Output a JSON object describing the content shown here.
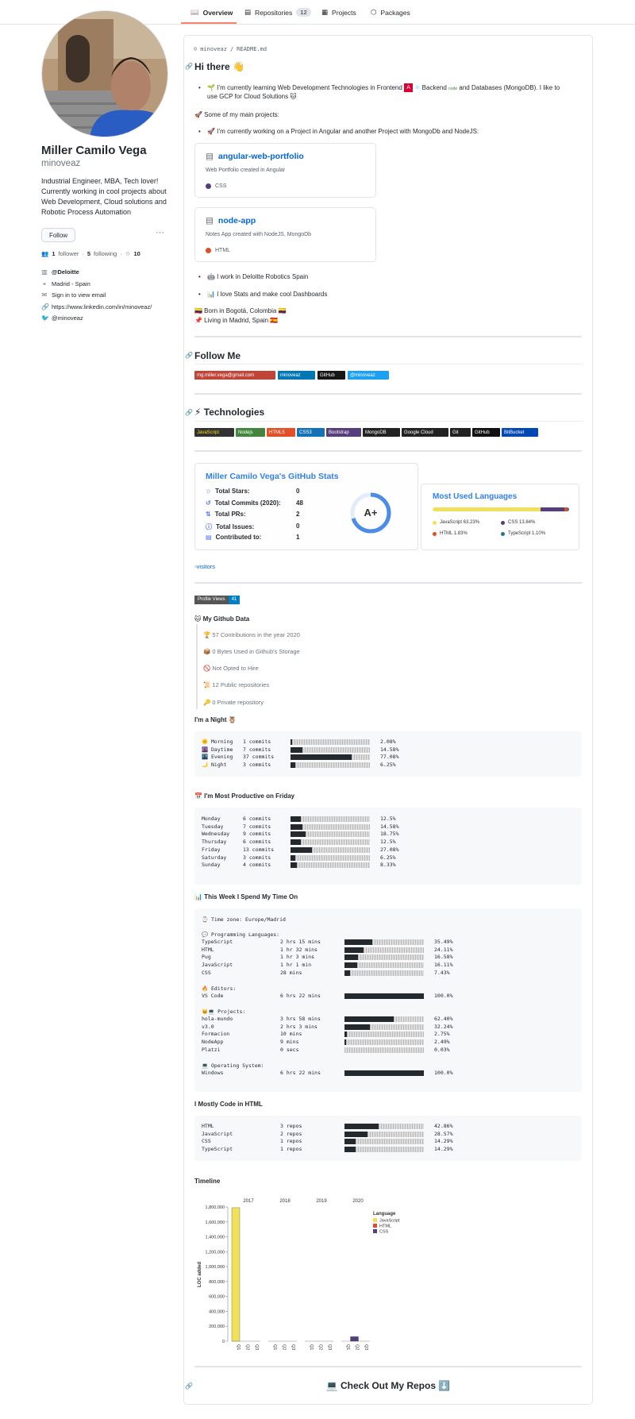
{
  "nav": {
    "tabs": [
      {
        "label": "Overview",
        "icon": "book-icon"
      },
      {
        "label": "Repositories",
        "icon": "repo-icon",
        "count": "12"
      },
      {
        "label": "Projects",
        "icon": "project-icon"
      },
      {
        "label": "Packages",
        "icon": "package-icon"
      }
    ]
  },
  "profile": {
    "name": "Miller Camilo Vega",
    "login": "minoveaz",
    "bio": "Industrial Engineer, MBA, Tech lover! Currently working in cool projects about Web Development, Cloud solutions and Robotic Process Automation",
    "follow_label": "Follow",
    "more_label": "···",
    "followers_count": "1",
    "followers_label": "follower",
    "following_count": "5",
    "following_label": "following",
    "separator": "·",
    "stars_count": "10",
    "company": "@Deloitte",
    "location": "Madrid - Spain",
    "email": "Sign in to view email",
    "website": "https://www.linkedin.com/in/minoveaz/",
    "twitter": "@minoveaz"
  },
  "readme": {
    "path_user": "minoveaz",
    "path_sep": "/",
    "path_file": "README.md",
    "hi_title": "Hi there 👋",
    "bullet1": "🌱 I’m currently learning Web Development Technologies in Frontend",
    "bullet1_b": "Backend",
    "bullet1_c": "and Databases (MongoDB). I like to",
    "bullet1_d": "use GCP for Cloud Solutions",
    "projects_intro": "🚀 Some of my main projects:",
    "bullet2": "🚀 I’m currently working on a Project in Angular and another Project with MongoDb and NodeJS:",
    "repos": [
      {
        "name": "angular-web-portfolio",
        "desc": "Web Portfolio created in Angular",
        "lang": "CSS",
        "lang_color": "#563d7c"
      },
      {
        "name": "node-app",
        "desc": "Notes App created with NodeJS, MongoDb",
        "lang": "HTML",
        "lang_color": "#e34c26"
      }
    ],
    "bullet3": "🤖 I work in Deloitte Robotics Spain",
    "bullet4": "📊 I love Stats and make cool Dashboards",
    "born": "🇨🇴 Born in Bogotá, Colombia 🇨🇴",
    "living": "📌 Living in Madrid, Spain 🇪🇸",
    "follow_title": "Follow Me",
    "follow_badges": [
      {
        "label": "mg.miller.vega@gmail.com",
        "color": "#c14438"
      },
      {
        "label": "minoveaz",
        "color": "#0077b5"
      },
      {
        "label": "GitHub",
        "color": "#181717"
      },
      {
        "label": "@minoveaz",
        "color": "#1ca0f2"
      }
    ],
    "tech_title": "⚡ Technologies",
    "tech_badges": [
      {
        "label": "JavaScript",
        "color": "#323330"
      },
      {
        "label": "Nodejs",
        "color": "#43853d"
      },
      {
        "label": "HTML5",
        "color": "#e34f26"
      },
      {
        "label": "CSS3",
        "color": "#1572b6"
      },
      {
        "label": "Bootstrap",
        "color": "#563d7c"
      },
      {
        "label": "MongoDB",
        "color": "#222222"
      },
      {
        "label": "Google Cloud",
        "color": "#222222"
      },
      {
        "label": "Git",
        "color": "#222222"
      },
      {
        "label": "GitHub",
        "color": "#121011"
      },
      {
        "label": "BitBucket",
        "color": "#0047b3"
      }
    ],
    "stats": {
      "title": "Miller Camilo Vega's GitHub Stats",
      "rows": [
        {
          "label": "Total Stars:",
          "value": "0",
          "icon": "star-icon"
        },
        {
          "label": "Total Commits (2020):",
          "value": "48",
          "icon": "history-icon"
        },
        {
          "label": "Total PRs:",
          "value": "2",
          "icon": "pull-request-icon"
        },
        {
          "label": "Total Issues:",
          "value": "0",
          "icon": "issue-icon"
        },
        {
          "label": "Contributed to:",
          "value": "1",
          "icon": "repo-icon"
        }
      ],
      "grade": "A+",
      "grade_progress": 0.7
    },
    "langs": {
      "title": "Most Used Languages",
      "items": [
        {
          "label": "JavaScript 63.23%",
          "color": "#f1e05a",
          "pct": 63.23
        },
        {
          "label": "CSS 13.84%",
          "color": "#563d7c",
          "pct": 13.84
        },
        {
          "label": "HTML 1.83%",
          "color": "#e34c26",
          "pct": 1.83
        },
        {
          "label": "TypeScript 1.10%",
          "color": "#2b7489",
          "pct": 1.1
        }
      ]
    },
    "visitors_alt": "visitors",
    "profile_views_label": "Profile Views",
    "profile_views_value": "41",
    "gh_data_title": "🐱 My Github Data",
    "gh_data": [
      "🏆 57 Contributions in the year 2020",
      "📦 0 Bytes Used in Github's Storage",
      "🚫 Not Opted to Hire",
      "📜 12 Public repositories",
      "🔑 0 Private repository"
    ],
    "night_title": "I'm a Night 🦉",
    "night_rows": [
      {
        "name": "🌞 Morning",
        "value": "1 commits",
        "pct": "2.08%",
        "frac": 0.0208
      },
      {
        "name": "🌆 Daytime",
        "value": "7 commits",
        "pct": "14.58%",
        "frac": 0.1458
      },
      {
        "name": "🌃 Evening",
        "value": "37 commits",
        "pct": "77.08%",
        "frac": 0.7708
      },
      {
        "name": "🌙 Night",
        "value": "3 commits",
        "pct": "6.25%",
        "frac": 0.0625
      }
    ],
    "productive_title": "📅 I'm Most Productive on Friday",
    "productive_rows": [
      {
        "name": "Monday",
        "value": "6 commits",
        "pct": "12.5%",
        "frac": 0.125
      },
      {
        "name": "Tuesday",
        "value": "7 commits",
        "pct": "14.58%",
        "frac": 0.1458
      },
      {
        "name": "Wednesday",
        "value": "9 commits",
        "pct": "18.75%",
        "frac": 0.1875
      },
      {
        "name": "Thursday",
        "value": "6 commits",
        "pct": "12.5%",
        "frac": 0.125
      },
      {
        "name": "Friday",
        "value": "13 commits",
        "pct": "27.08%",
        "frac": 0.2708
      },
      {
        "name": "Saturday",
        "value": "3 commits",
        "pct": "6.25%",
        "frac": 0.0625
      },
      {
        "name": "Sunday",
        "value": "4 commits",
        "pct": "8.33%",
        "frac": 0.0833
      }
    ],
    "week_title": "📊 This Week I Spend My Time On",
    "timezone": "⌚ Time zone: Europe/Madrid",
    "lang_head": "💬 Programming Languages:",
    "week_langs": [
      {
        "name": "TypeScript",
        "value": "2 hrs 15 mins",
        "pct": "35.49%",
        "frac": 0.3549
      },
      {
        "name": "HTML",
        "value": "1 hr 32 mins",
        "pct": "24.11%",
        "frac": 0.2411
      },
      {
        "name": "Pug",
        "value": "1 hr 3 mins",
        "pct": "16.58%",
        "frac": 0.1658
      },
      {
        "name": "JavaScript",
        "value": "1 hr 1 min",
        "pct": "16.11%",
        "frac": 0.1611
      },
      {
        "name": "CSS",
        "value": "28 mins",
        "pct": "7.43%",
        "frac": 0.0743
      }
    ],
    "editor_head": "🔥 Editors:",
    "week_editors": [
      {
        "name": "VS Code",
        "value": "6 hrs 22 mins",
        "pct": "100.0%",
        "frac": 1.0
      }
    ],
    "project_head": "🐱‍💻 Projects:",
    "week_projects": [
      {
        "name": "hola-mundo",
        "value": "3 hrs 58 mins",
        "pct": "62.40%",
        "frac": 0.624
      },
      {
        "name": "v3.0",
        "value": "2 hrs 3 mins",
        "pct": "32.24%",
        "frac": 0.3224
      },
      {
        "name": "Formacion",
        "value": "10 mins",
        "pct": "2.75%",
        "frac": 0.0275
      },
      {
        "name": "NodeApp",
        "value": "9 mins",
        "pct": "2.49%",
        "frac": 0.0249
      },
      {
        "name": "Platzi",
        "value": "0 secs",
        "pct": "0.03%",
        "frac": 0.0003
      }
    ],
    "os_head": "💻 Operating System:",
    "week_os": [
      {
        "name": "Windows",
        "value": "6 hrs 22 mins",
        "pct": "100.0%",
        "frac": 1.0
      }
    ],
    "code_title": "I Mostly Code in HTML",
    "code_rows": [
      {
        "name": "HTML",
        "value": "3 repos",
        "pct": "42.86%",
        "frac": 0.4286
      },
      {
        "name": "JavaScript",
        "value": "2 repos",
        "pct": "28.57%",
        "frac": 0.2857
      },
      {
        "name": "CSS",
        "value": "1 repos",
        "pct": "14.29%",
        "frac": 0.1429
      },
      {
        "name": "TypeScript",
        "value": "1 repos",
        "pct": "14.29%",
        "frac": 0.1429
      }
    ],
    "timeline_title": "Timeline",
    "repos_title": "💻 Check Out My Repos ⬇️"
  },
  "chart_data": {
    "type": "bar",
    "title": "",
    "xlabel": "",
    "ylabel": "LOC added",
    "years": [
      "2017",
      "2018",
      "2019",
      "2020"
    ],
    "categories": [
      "Q1",
      "Q2",
      "Q3",
      "Q1",
      "Q2",
      "Q3",
      "Q1",
      "Q2",
      "Q3",
      "Q1",
      "Q2",
      "Q3"
    ],
    "legend_title": "Language",
    "legend_position": "top-right",
    "series": [
      {
        "name": "JavaScript",
        "color": "#f1e05a",
        "values": [
          1790000,
          0,
          0,
          0,
          0,
          0,
          0,
          0,
          0,
          0,
          0,
          0
        ]
      },
      {
        "name": "HTML",
        "color": "#e34c26",
        "values": [
          0,
          0,
          0,
          0,
          0,
          0,
          0,
          0,
          0,
          0,
          0,
          0
        ]
      },
      {
        "name": "CSS",
        "color": "#563d7c",
        "values": [
          0,
          0,
          0,
          0,
          0,
          0,
          0,
          0,
          0,
          0,
          60000,
          0
        ]
      }
    ],
    "yticks": [
      "0",
      "200,000",
      "400,000",
      "600,000",
      "800,000",
      "1,000,000",
      "1,200,000",
      "1,400,000",
      "1,600,000",
      "1,800,000"
    ],
    "ylim": [
      0,
      1800000
    ]
  }
}
